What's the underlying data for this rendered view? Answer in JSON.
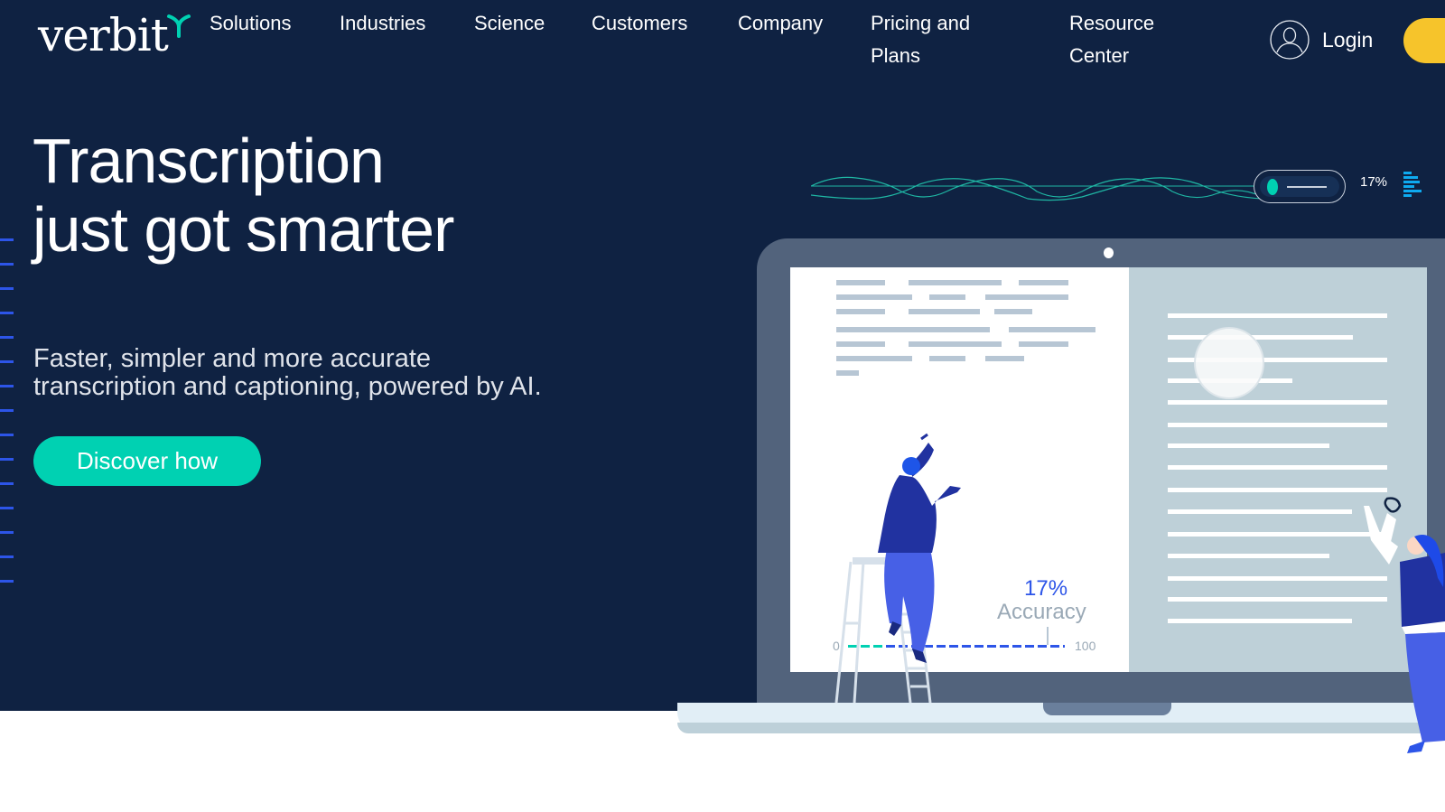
{
  "brand": {
    "logo_text": "verbit",
    "accent": "#00d1b2",
    "background": "#0f2242",
    "cta_yellow": "#f6c42b"
  },
  "nav": {
    "items": [
      {
        "label": "Solutions"
      },
      {
        "label": "Industries"
      },
      {
        "label": "Science"
      },
      {
        "label": "Customers"
      },
      {
        "label": "Company"
      },
      {
        "label": "Pricing and Plans"
      },
      {
        "label": "Resource Center"
      }
    ],
    "login_label": "Login",
    "login_icon": "user-circle-icon"
  },
  "hero": {
    "headline_line1": "Transcription",
    "headline_line2": "just got smarter",
    "subhead_line1": "Faster, simpler and more accurate",
    "subhead_line2": "transcription and captioning, powered by AI.",
    "cta_label": "Discover how"
  },
  "illustration": {
    "wave_percent": "17%",
    "accuracy_percent": "17%",
    "accuracy_label": "Accuracy",
    "accuracy_value": 17,
    "scale_min": "0",
    "scale_max": "100"
  }
}
